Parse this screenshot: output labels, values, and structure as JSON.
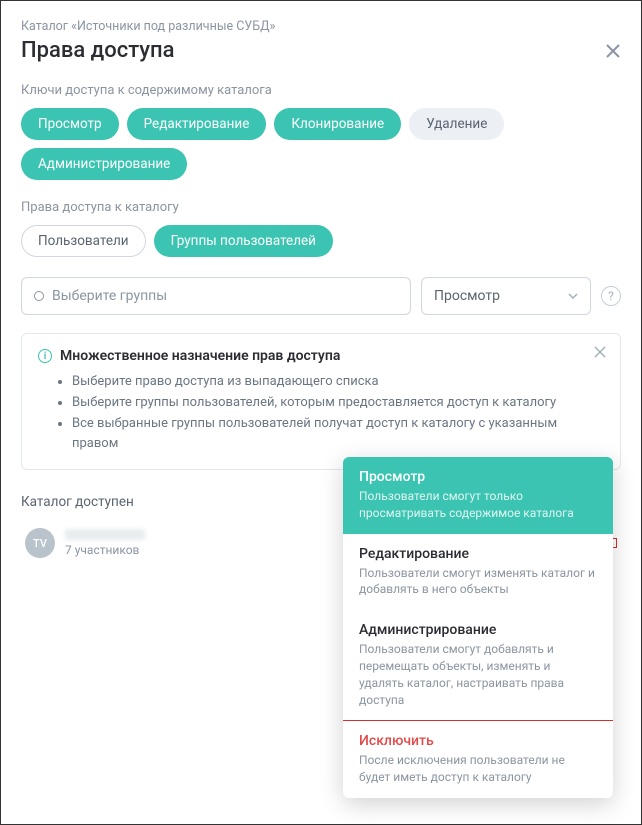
{
  "breadcrumb": "Каталог «Источники под различные СУБД»",
  "title": "Права доступа",
  "section_keys": "Ключи доступа к содержимому каталога",
  "keys": {
    "view": "Просмотр",
    "edit": "Редактирование",
    "clone": "Клонирование",
    "delete": "Удаление",
    "admin": "Администрирование"
  },
  "section_rights": "Права доступа к каталогу",
  "tabs": {
    "users": "Пользователи",
    "groups": "Группы пользователей"
  },
  "group_placeholder": "Выберите группы",
  "perm_selected": "Просмотр",
  "info": {
    "title": "Множественное назначение прав доступа",
    "bullets": [
      "Выберите право доступа из выпадающего списка",
      "Выберите группы пользователей, которым предоставляется доступ к каталогу",
      "Все выбранные группы пользователей получат доступ к каталогу с указанным правом"
    ]
  },
  "available_label": "Каталог доступен",
  "avatar_initials": "TV",
  "group_members": "7 участников",
  "row_perm": "Просмотр",
  "dropdown": {
    "view": {
      "title": "Просмотр",
      "desc": "Пользователи смогут только просматривать содержимое каталога"
    },
    "edit": {
      "title": "Редактирование",
      "desc": "Пользователи смогут изменять каталог и добавлять в него объекты"
    },
    "admin": {
      "title": "Администрирование",
      "desc": "Пользователи смогут добавлять и перемещать объекты, изменять и удалять каталог, настраивать права доступа"
    },
    "exclude": {
      "title": "Исключить",
      "desc": "После исключения пользователи не будет иметь доступ к каталогу"
    }
  }
}
